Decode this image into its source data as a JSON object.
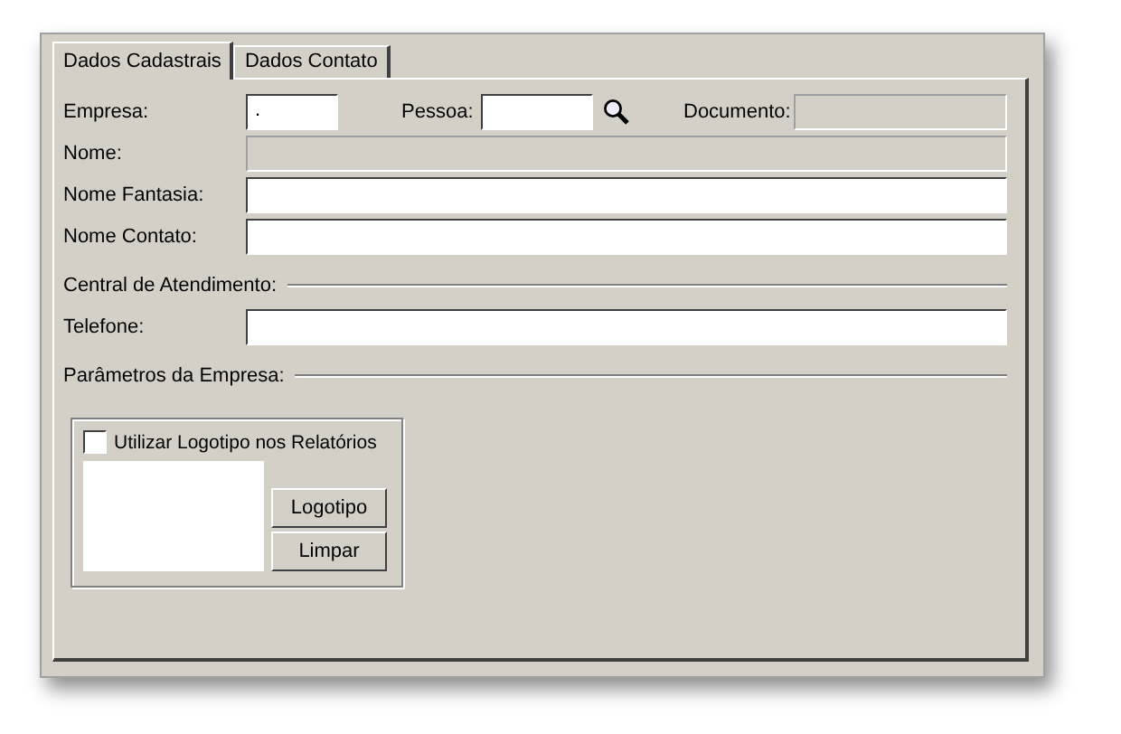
{
  "tabs": [
    {
      "label": "Dados Cadastrais",
      "selected": true
    },
    {
      "label": "Dados Contato",
      "selected": false
    }
  ],
  "top_row": {
    "empresa": {
      "label": "Empresa:",
      "value": "."
    },
    "pessoa": {
      "label": "Pessoa:"
    },
    "documento": {
      "label": "Documento:",
      "disabled": true
    }
  },
  "fields": [
    {
      "label": "Nome:",
      "disabled": true
    },
    {
      "label": "Nome Fantasia:",
      "disabled": false
    },
    {
      "label": "Nome Contato:",
      "disabled": false
    }
  ],
  "central_section": {
    "title": "Central de Atendimento:",
    "fields": [
      {
        "label": "Telefone:",
        "disabled": false
      }
    ]
  },
  "parametros_section": {
    "title": "Parâmetros da Empresa:",
    "checkbox": {
      "label": "Utilizar Logotipo nos Relatórios",
      "checked": false
    },
    "buttons": [
      "Logotipo",
      "Limpar"
    ]
  }
}
